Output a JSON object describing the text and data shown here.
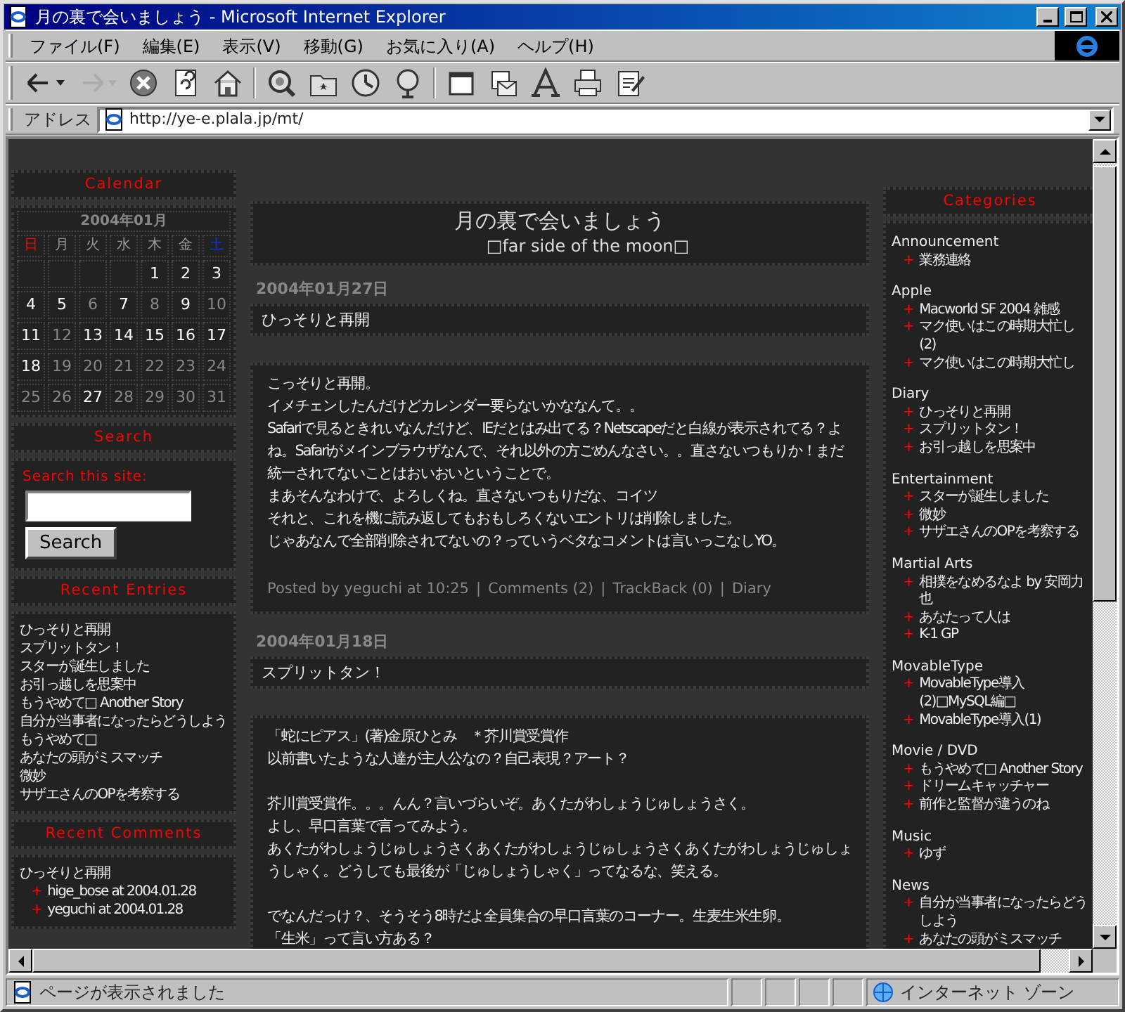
{
  "window": {
    "title": "月の裏で会いましょう - Microsoft Internet Explorer"
  },
  "menu": [
    "ファイル(F)",
    "編集(E)",
    "表示(V)",
    "移動(G)",
    "お気に入り(A)",
    "ヘルプ(H)"
  ],
  "toolbar_groups": [
    {
      "buttons": [
        {
          "kind": "back",
          "disabled": false,
          "dropdown": true
        },
        {
          "kind": "forward",
          "disabled": true,
          "dropdown": true
        },
        {
          "kind": "stop",
          "disabled": false,
          "dropdown": false
        },
        {
          "kind": "refresh",
          "disabled": false,
          "dropdown": false
        },
        {
          "kind": "home",
          "disabled": false,
          "dropdown": false
        }
      ]
    },
    {
      "buttons": [
        {
          "kind": "search",
          "disabled": false,
          "dropdown": false
        },
        {
          "kind": "favorites",
          "disabled": false,
          "dropdown": false
        },
        {
          "kind": "history",
          "disabled": false,
          "dropdown": false
        },
        {
          "kind": "channels",
          "disabled": false,
          "dropdown": false
        }
      ]
    },
    {
      "buttons": [
        {
          "kind": "fullscreen",
          "disabled": false,
          "dropdown": false
        },
        {
          "kind": "mail",
          "disabled": false,
          "dropdown": false
        },
        {
          "kind": "font",
          "disabled": false,
          "dropdown": false
        },
        {
          "kind": "print",
          "disabled": false,
          "dropdown": false
        },
        {
          "kind": "edit",
          "disabled": false,
          "dropdown": false
        }
      ]
    }
  ],
  "address": {
    "label": "アドレス",
    "value": "http://ye-e.plala.jp/mt/"
  },
  "left_sidebar": {
    "calendar": {
      "title": "Calendar",
      "month": "2004年01月",
      "weekdays": [
        {
          "label": "日",
          "color": "#ff0000"
        },
        {
          "label": "月",
          "color": "#999999"
        },
        {
          "label": "火",
          "color": "#999999"
        },
        {
          "label": "水",
          "color": "#999999"
        },
        {
          "label": "木",
          "color": "#999999"
        },
        {
          "label": "金",
          "color": "#999999"
        },
        {
          "label": "土",
          "color": "#0033ff"
        }
      ],
      "days": [
        {
          "kind": "blank"
        },
        {
          "kind": "blank"
        },
        {
          "kind": "blank"
        },
        {
          "kind": "blank"
        },
        {
          "kind": "day",
          "label": "1",
          "linked": true
        },
        {
          "kind": "day",
          "label": "2",
          "linked": true
        },
        {
          "kind": "day",
          "label": "3",
          "linked": true
        },
        {
          "kind": "day",
          "label": "4",
          "linked": true
        },
        {
          "kind": "day",
          "label": "5",
          "linked": true
        },
        {
          "kind": "day",
          "label": "6",
          "linked": false
        },
        {
          "kind": "day",
          "label": "7",
          "linked": true
        },
        {
          "kind": "day",
          "label": "8",
          "linked": false
        },
        {
          "kind": "day",
          "label": "9",
          "linked": true
        },
        {
          "kind": "day",
          "label": "10",
          "linked": false
        },
        {
          "kind": "day",
          "label": "11",
          "linked": true
        },
        {
          "kind": "day",
          "label": "12",
          "linked": false
        },
        {
          "kind": "day",
          "label": "13",
          "linked": true
        },
        {
          "kind": "day",
          "label": "14",
          "linked": true
        },
        {
          "kind": "day",
          "label": "15",
          "linked": true
        },
        {
          "kind": "day",
          "label": "16",
          "linked": true
        },
        {
          "kind": "day",
          "label": "17",
          "linked": true
        },
        {
          "kind": "day",
          "label": "18",
          "linked": true
        },
        {
          "kind": "day",
          "label": "19",
          "linked": false
        },
        {
          "kind": "day",
          "label": "20",
          "linked": false
        },
        {
          "kind": "day",
          "label": "21",
          "linked": false
        },
        {
          "kind": "day",
          "label": "22",
          "linked": false
        },
        {
          "kind": "day",
          "label": "23",
          "linked": false
        },
        {
          "kind": "day",
          "label": "24",
          "linked": false
        },
        {
          "kind": "day",
          "label": "25",
          "linked": false
        },
        {
          "kind": "day",
          "label": "26",
          "linked": false
        },
        {
          "kind": "day",
          "label": "27",
          "linked": true
        },
        {
          "kind": "day",
          "label": "28",
          "linked": false
        },
        {
          "kind": "day",
          "label": "29",
          "linked": false
        },
        {
          "kind": "day",
          "label": "30",
          "linked": false
        },
        {
          "kind": "day",
          "label": "31",
          "linked": false
        }
      ]
    },
    "search": {
      "title": "Search",
      "label": "Search this site:",
      "button": "Search"
    },
    "recent_entries": {
      "title": "Recent Entries",
      "items": [
        "ひっそりと再開",
        "スプリットタン！",
        "スターが誕生しました",
        "お引っ越しを思案中",
        "もうやめて□ Another Story",
        "自分が当事者になったらどうしよう",
        "もうやめて□",
        "あなたの頭がミスマッチ",
        "微妙",
        "サザエさんのOPを考察する"
      ]
    },
    "recent_comments": {
      "title": "Recent Comments",
      "marker": "+",
      "entries": [
        {
          "title": "ひっそりと再開",
          "comments": [
            "hige_bose  at 2004.01.28",
            "yeguchi  at 2004.01.28"
          ]
        }
      ]
    }
  },
  "main": {
    "header": {
      "title": "月の裏で会いましょう",
      "subtitle": "□far side of the moon□"
    },
    "posts": [
      {
        "date": "2004年01月27日",
        "title": "ひっそりと再開",
        "paragraphs": [
          [
            "こっそりと再開。",
            "イメチェンしたんだけどカレンダー要らないかななんて。。",
            "Safariで見るときれいなんだけど、IEだとはみ出てる？Netscapeだと白線が表示されてる？よね。Safariがメインブラウザなんで、それ以外の方ごめんなさい。。直さないつもりか！まだ統一されてないことはおいおいということで。",
            "まあそんなわけで、よろしくね。直さないつもりだな、コイツ",
            "それと、これを機に読み返してもおもしろくないエントリは削除しました。",
            "じゃあなんで全部削除されてないの？っていうベタなコメントは言いっこなしYO。"
          ]
        ],
        "footer": {
          "text": "Posted by yeguchi at 10:25",
          "separator": "|",
          "links": [
            "Comments (2)",
            "TrackBack (0)",
            "Diary"
          ]
        }
      },
      {
        "date": "2004年01月18日",
        "title": "スプリットタン！",
        "paragraphs": [
          [
            "「蛇にピアス」(著)金原ひとみ　＊芥川賞受賞作",
            "以前書いたような人達が主人公なの？自己表現？アート？"
          ],
          [
            "芥川賞受賞作。。。んん？言いづらいぞ。あくたがわしょうじゅしょうさく。",
            "よし、早口言葉で言ってみよう。",
            "あくたがわしょうじゅしょうさくあくたがわしょうじゅしょうさくあくたがわしょうじゅしょうしゃく。どうしても最後が「じゅしょうしゃく」ってなるな、笑える。"
          ],
          [
            "でなんだっけ？、そうそう8時だよ全員集合の早口言葉のコーナー。生麦生米生卵。",
            "「生米」って言い方ある？"
          ]
        ]
      }
    ]
  },
  "right_sidebar": {
    "categories": {
      "title": "Categories",
      "marker": "+",
      "groups": [
        {
          "name": "Announcement",
          "items": [
            "業務連絡"
          ]
        },
        {
          "name": "Apple",
          "items": [
            "Macworld SF 2004 雑感",
            "マク使いはこの時期大忙し(2)",
            "マク使いはこの時期大忙し"
          ]
        },
        {
          "name": "Diary",
          "items": [
            "ひっそりと再開",
            "スプリットタン！",
            "お引っ越しを思案中"
          ]
        },
        {
          "name": "Entertainment",
          "items": [
            "スターが誕生しました",
            "微妙",
            "サザエさんのOPを考察する"
          ]
        },
        {
          "name": "Martial Arts",
          "items": [
            "相撲をなめるなよ by 安岡力也",
            "あなたって人は",
            "K-1 GP"
          ]
        },
        {
          "name": "MovableType",
          "items": [
            "MovableType導入(2)□MySQL編□",
            "MovableType導入(1)"
          ]
        },
        {
          "name": "Movie / DVD",
          "items": [
            "もうやめて□ Another Story",
            "ドリームキャッチャー",
            "前作と監督が違うのね"
          ]
        },
        {
          "name": "Music",
          "items": [
            "ゆず"
          ]
        },
        {
          "name": "News",
          "items": [
            "自分が当事者になったらどうしよう",
            "あなたの頭がミスマッチ"
          ]
        }
      ]
    }
  },
  "status_bar": {
    "text": "ページが表示されました",
    "zone": "インターネット ゾーン"
  }
}
